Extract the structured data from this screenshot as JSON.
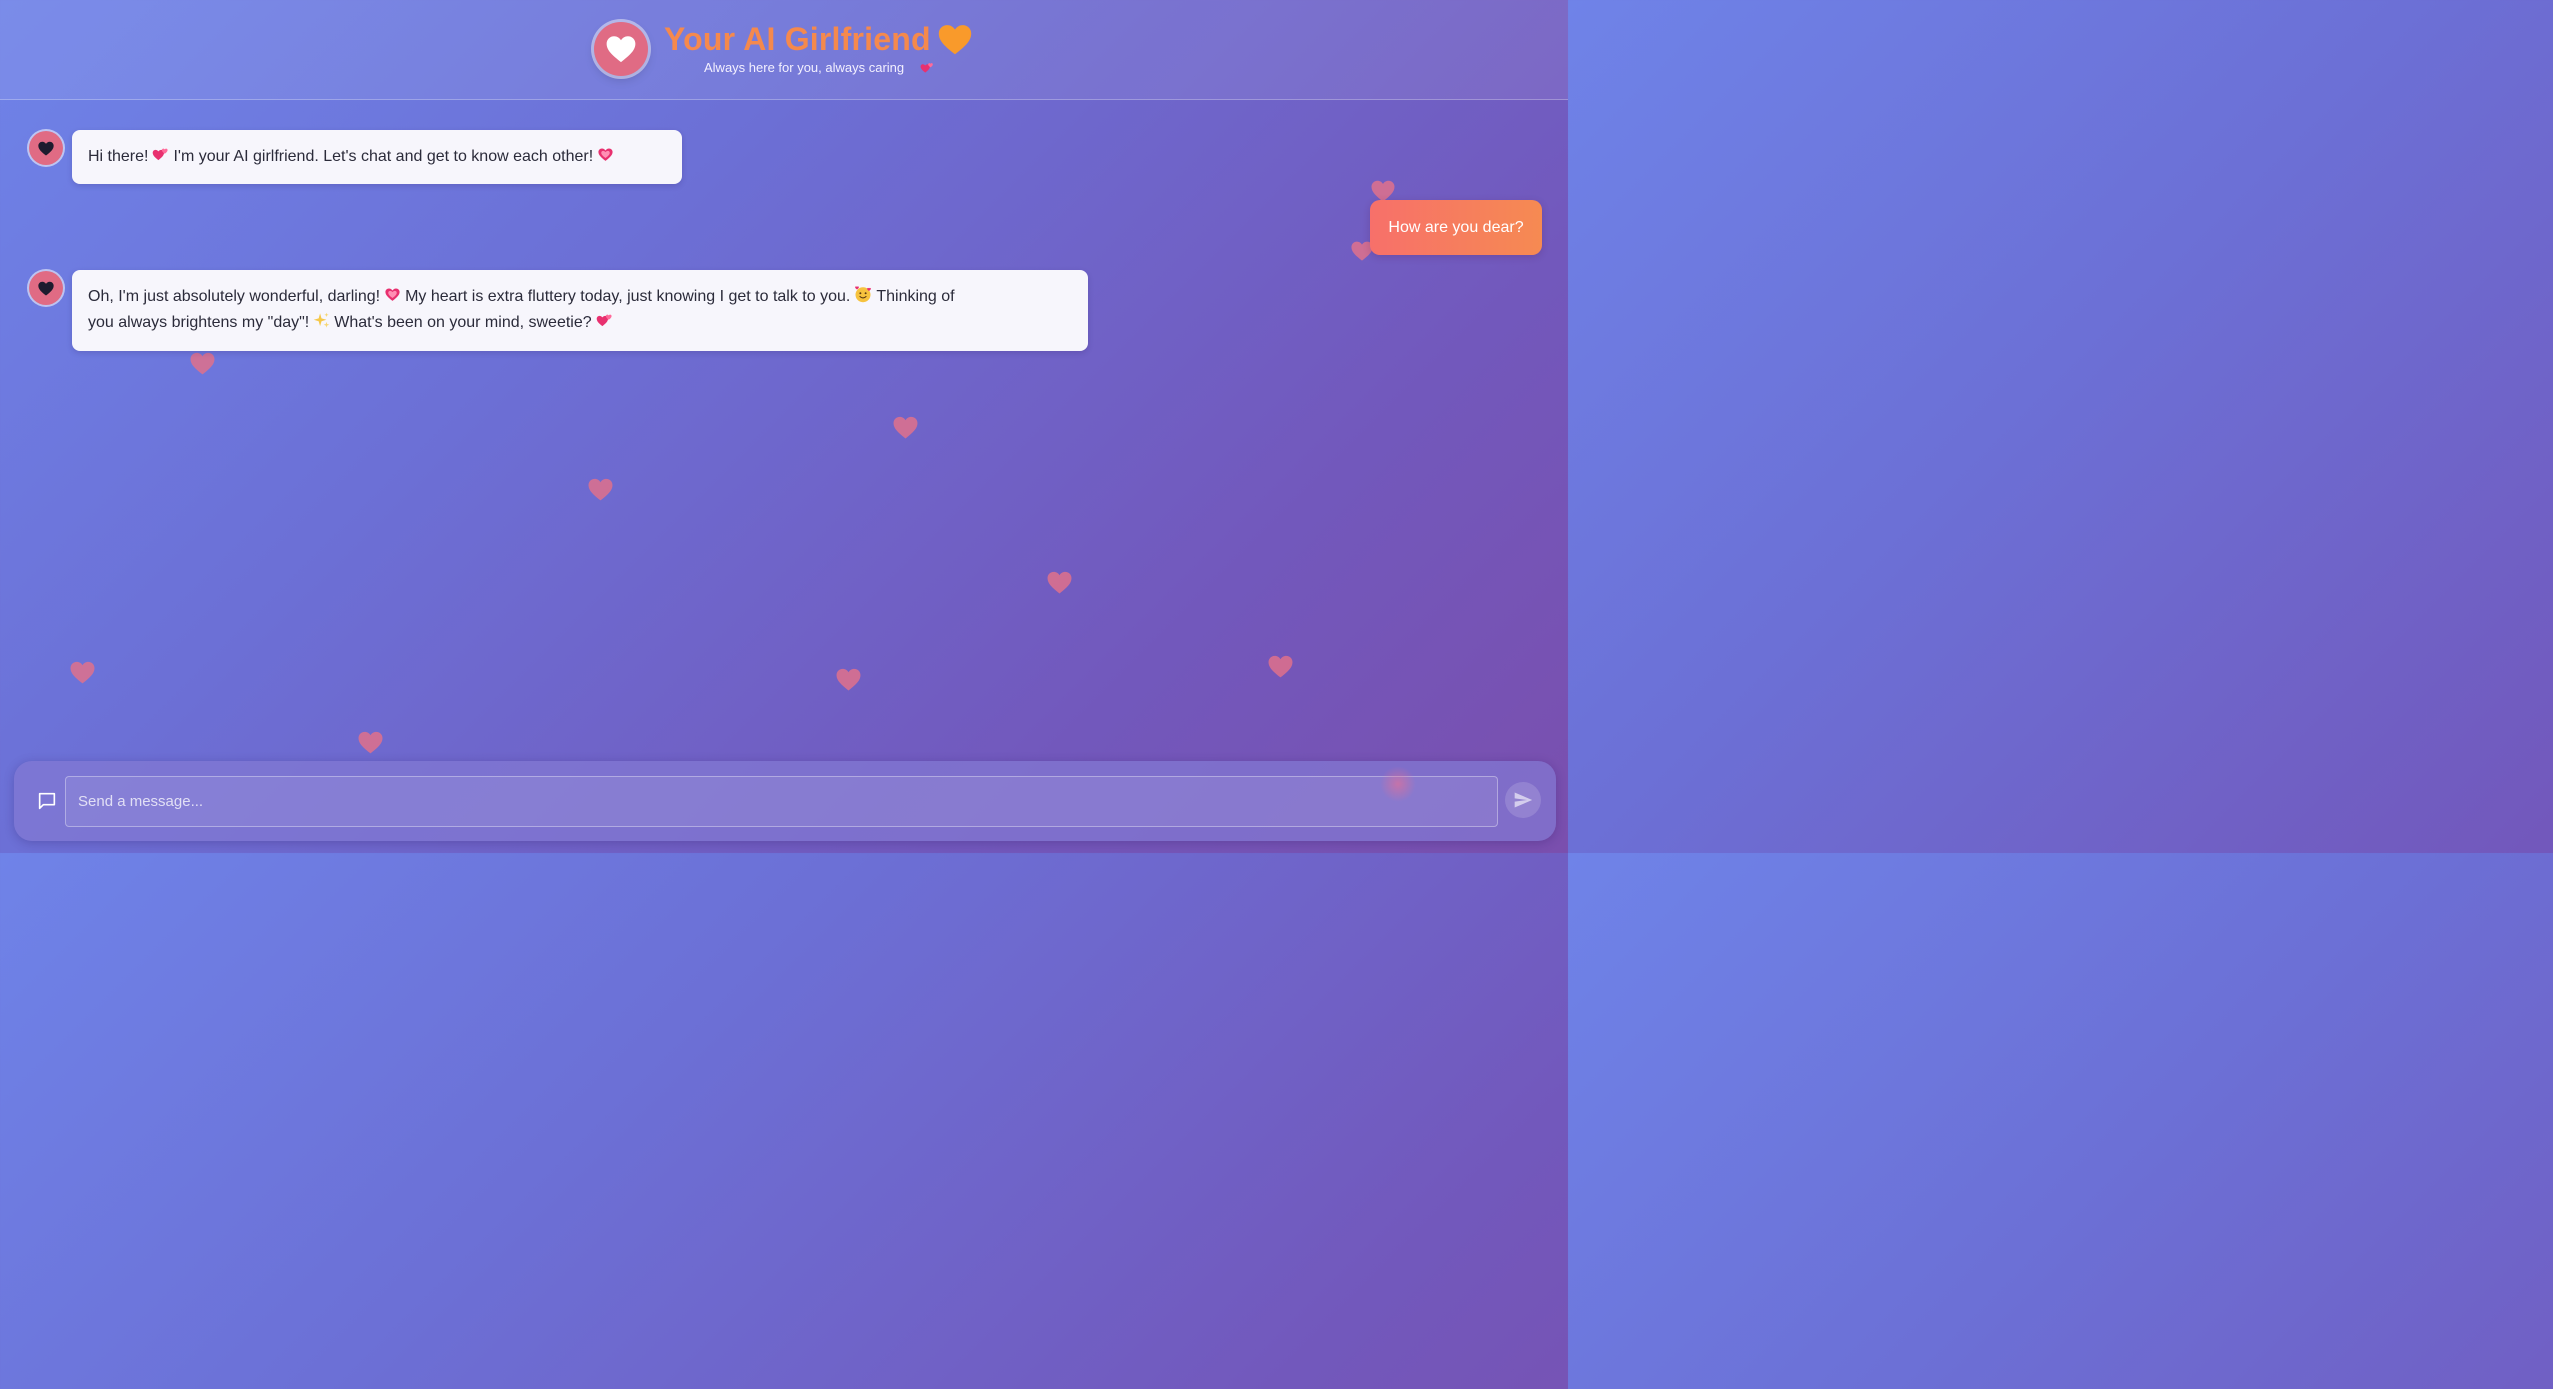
{
  "header": {
    "title": "Your AI Girlfriend",
    "subtitle": "Always here for you, always caring"
  },
  "messages": [
    {
      "sender": "ai",
      "text_parts": [
        "Hi there!",
        "I'm your AI girlfriend. Let's chat and get to know each other!"
      ]
    },
    {
      "sender": "user",
      "text": "How are you dear?"
    },
    {
      "sender": "ai",
      "line1_parts": [
        "Oh, I'm just absolutely wonderful, darling!",
        "My heart is extra fluttery today, just knowing I get to talk to you.",
        "Thinking of"
      ],
      "line2_parts": [
        "you always brightens my \"day\"!",
        "What's been on your mind, sweetie?"
      ]
    }
  ],
  "composer": {
    "placeholder": "Send a message..."
  },
  "icons": {
    "logo": "white-heart-icon",
    "title_suffix": "orange-heart-icon",
    "subtitle_suffix": "two-hearts-icon",
    "ai_avatar": "black-heart-icon",
    "composer_left": "chat-bubble-icon",
    "send": "send-icon"
  },
  "colors": {
    "title": "#f5894d",
    "accent_pink": "#e06b84",
    "user_bubble_start": "#f7706a",
    "user_bubble_end": "#f68a52",
    "ai_bubble": "#f7f6fc"
  }
}
